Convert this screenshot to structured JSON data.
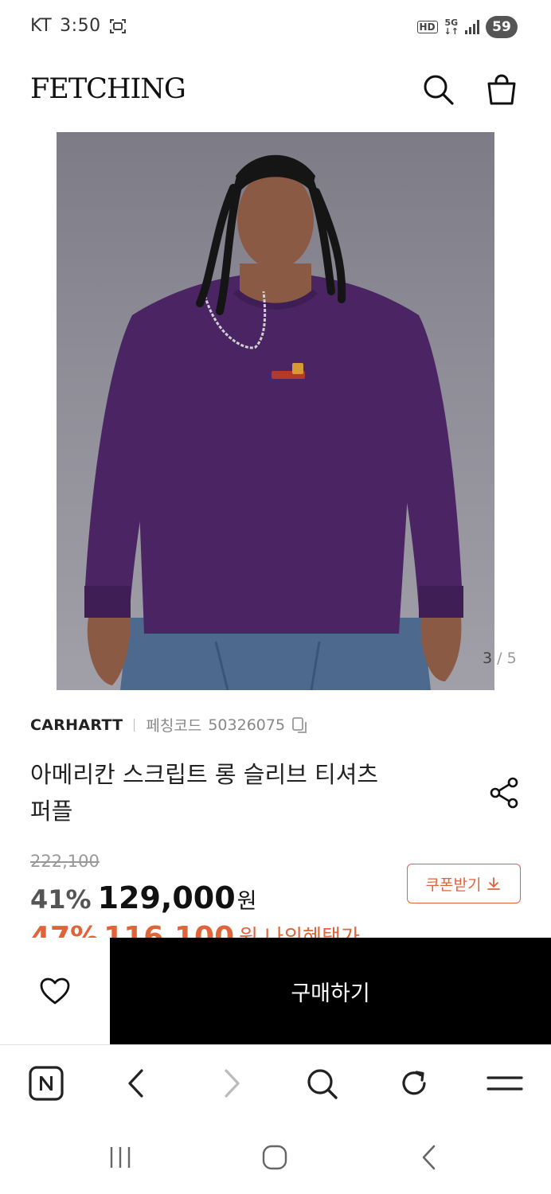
{
  "status_bar": {
    "carrier": "KT",
    "time": "3:50",
    "network_hd": "HD",
    "network_5g": "5G",
    "battery": "59"
  },
  "header": {
    "logo": "FETCHING",
    "icons": [
      "search-icon",
      "shopping-bag-icon"
    ]
  },
  "gallery": {
    "current": "3",
    "separator": "/",
    "total": "5",
    "shirt_color": "#4a2463"
  },
  "product": {
    "brand": "CARHARTT",
    "code_label": "페칭코드",
    "code": "50326075",
    "title_line1": "아메리칸 스크립트 롱 슬리브 티셔츠",
    "title_line2": "퍼플",
    "original_price": "222,100",
    "discount": "41%",
    "sale_price": "129,000",
    "currency": "원",
    "coupon_label": "쿠폰받기",
    "partial_discount": "47%",
    "partial_price": "116,100",
    "partial_label": "원 나의혜택가"
  },
  "actions": {
    "buy_label": "구매하기"
  },
  "browser_toolbar": {
    "buttons": [
      "naver-icon",
      "back-icon",
      "forward-icon",
      "search-icon",
      "refresh-icon",
      "menu-icon"
    ]
  },
  "system_nav": {
    "buttons": [
      "recent-apps-icon",
      "home-icon",
      "back-icon"
    ]
  },
  "colors": {
    "accent": "#e0643a",
    "buy_button": "#000000"
  }
}
